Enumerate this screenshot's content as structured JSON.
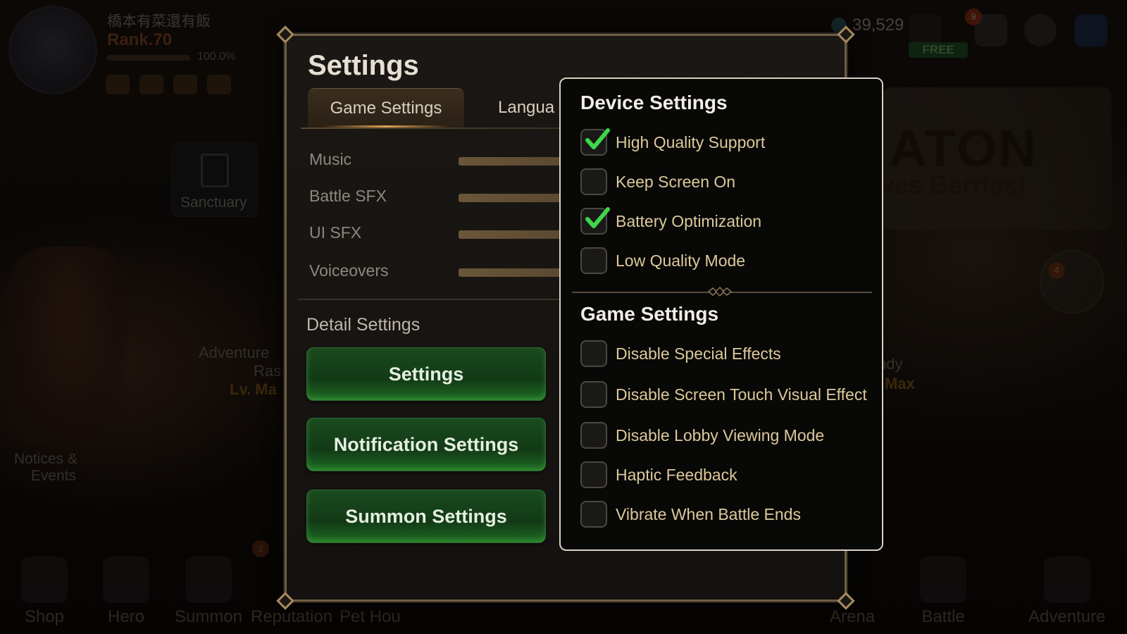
{
  "player": {
    "name": "橋本有菜還有飯",
    "rank": "Rank.70",
    "rank_pct": "100.0%"
  },
  "resources": {
    "energy": "39,529",
    "free_label": "FREE",
    "mail_badge": "9"
  },
  "background": {
    "sanctuary_label": "Sanctuary",
    "banner_title": "ATON",
    "banner_sub": "ves Berries!",
    "adventure_left_1": "Adventure",
    "adventure_left_2": "Ras",
    "adventure_left_lv": "Lv. Ma",
    "right_text_1": "ndy",
    "right_text_2": "Max",
    "girl_badge": "4",
    "notices_badge": "2"
  },
  "bottom_nav": [
    {
      "label": "Shop"
    },
    {
      "label": "Hero"
    },
    {
      "label": "Summon"
    },
    {
      "label": "Reputation"
    },
    {
      "label": "Pet Hou"
    },
    {
      "label": "Arena"
    },
    {
      "label": "Battle"
    },
    {
      "label": "Adventure"
    }
  ],
  "notices_label_1": "Notices &",
  "notices_label_2": "Events",
  "settings": {
    "title": "Settings",
    "tabs": [
      {
        "label": "Game Settings",
        "active": true
      },
      {
        "label": "Langua",
        "active": false
      }
    ],
    "volume": [
      {
        "label": "Music"
      },
      {
        "label": "Battle SFX"
      },
      {
        "label": "UI SFX"
      },
      {
        "label": "Voiceovers"
      }
    ],
    "detail_title": "Detail Settings",
    "buttons": [
      {
        "label": "Settings"
      },
      {
        "label": "Notification Settings"
      },
      {
        "label": "Summon Settings"
      }
    ]
  },
  "popup": {
    "device_title": "Device Settings",
    "device_options": [
      {
        "label": "High Quality Support",
        "checked": true
      },
      {
        "label": "Keep Screen On",
        "checked": false
      },
      {
        "label": "Battery Optimization",
        "checked": true
      },
      {
        "label": "Low Quality Mode",
        "checked": false
      }
    ],
    "game_title": "Game Settings",
    "game_options": [
      {
        "label": "Disable Special Effects",
        "checked": false
      },
      {
        "label": "Disable Screen Touch Visual Effect",
        "checked": false
      },
      {
        "label": "Disable Lobby Viewing Mode",
        "checked": false
      },
      {
        "label": "Haptic Feedback",
        "checked": false
      },
      {
        "label": "Vibrate When Battle Ends",
        "checked": false
      }
    ],
    "check_color": "#3fd64a"
  }
}
